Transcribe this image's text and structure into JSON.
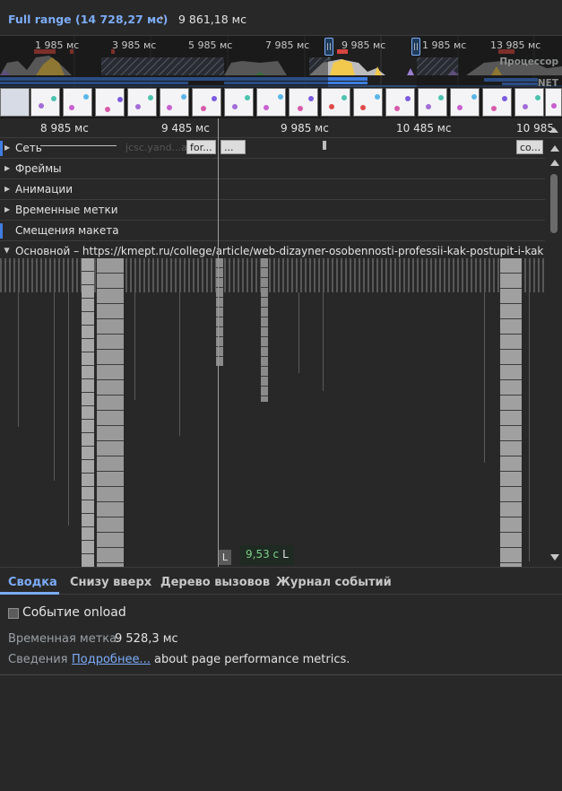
{
  "breadcrumb": {
    "full_range": "Full range (14 728,27 мс)",
    "separator": "›",
    "current": "9 861,18 мс"
  },
  "overview": {
    "ticks": [
      "1 985 мс",
      "3 985 мс",
      "5 985 мс",
      "7 985 мс",
      "9 985 мс",
      "1 985 мс",
      "13 985 мс"
    ],
    "cpu_label": "Процессор",
    "net_label": "NET",
    "handle_left": "||",
    "handle_right": "||"
  },
  "ruler": {
    "ticks": [
      "8 985 мс",
      "9 485 мс",
      "9 985 мс",
      "10 485 мс",
      "10 985"
    ]
  },
  "tracks": {
    "network": {
      "label": "Сеть",
      "chips": [
        "for...",
        "...",
        "co..."
      ],
      "faded_text": "jcsc.yand...ac"
    },
    "frames": "Фреймы",
    "animations": "Анимации",
    "timings": "Временные метки",
    "layout_shifts": "Смещения макета",
    "main": "Основной – https://kmept.ru/college/article/web-dizayner-osobennosti-professii-kak-postupit-i-kakie-ekzar",
    "marker_time": "9,53 с",
    "marker_letter": "L",
    "marker_box": "L"
  },
  "details": {
    "tabs": [
      "Сводка",
      "Снизу вверх",
      "Дерево вызовов",
      "Журнал событий"
    ],
    "active_tab": 0,
    "event_title": "Событие onload",
    "timestamp_label": "Временная метка",
    "timestamp_value": "9 528,3 мс",
    "info_label": "Сведения",
    "info_link": "Подробнее...",
    "info_text": " about page performance metrics."
  },
  "colors": {
    "accent": "#7cacf8",
    "cpu_scripting": "#f2c94c",
    "cpu_rendering": "#9b7fd1",
    "cpu_painting": "#5fb36a",
    "network_bar": "#3f7de0",
    "flame_gray": "#9a9a9a",
    "onload_marker": "#7dd18a"
  }
}
